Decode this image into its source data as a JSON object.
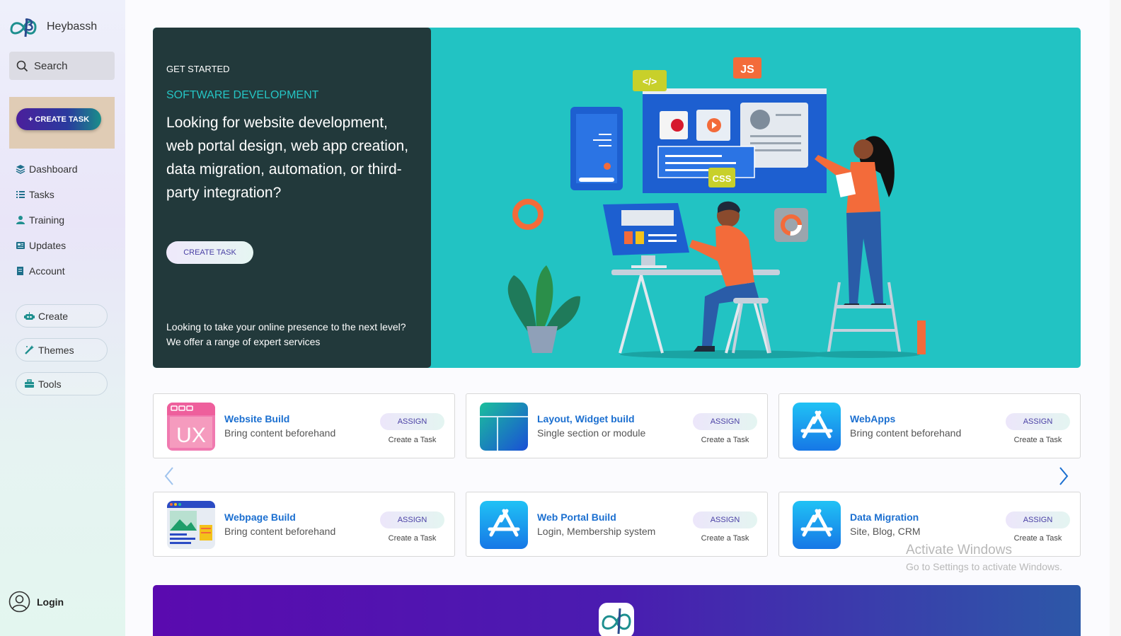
{
  "brand": {
    "name": "Heybassh"
  },
  "search": {
    "placeholder": "Search"
  },
  "sidebar": {
    "create_task_label": "+ CREATE TASK",
    "items": [
      {
        "label": "Dashboard",
        "icon": "layers-icon"
      },
      {
        "label": "Tasks",
        "icon": "list-check-icon"
      },
      {
        "label": "Training",
        "icon": "trainer-icon"
      },
      {
        "label": "Updates",
        "icon": "newspaper-icon"
      },
      {
        "label": "Account",
        "icon": "document-icon"
      }
    ],
    "pills": [
      {
        "label": "Create",
        "icon": "robot-icon"
      },
      {
        "label": "Themes",
        "icon": "magic-wand-icon"
      },
      {
        "label": "Tools",
        "icon": "toolbox-icon"
      }
    ],
    "login_label": "Login"
  },
  "hero": {
    "eyebrow": "GET STARTED",
    "subtitle": "SOFTWARE DEVELOPMENT",
    "title": "Looking for website development, web portal design, web app creation, data migration, automation, or third-party integration?",
    "cta_label": "CREATE TASK",
    "footer_line1": "Looking to take your online presence to the next level?",
    "footer_line2": "We offer a range of expert services",
    "art_labels": {
      "code": "</>",
      "js": "JS",
      "css": "CSS"
    }
  },
  "cards": [
    {
      "title": "Website Build",
      "desc": "Bring content beforehand",
      "assign": "ASSIGN",
      "action": "Create a Task",
      "icon": "ux-design-icon"
    },
    {
      "title": "Layout, Widget build",
      "desc": "Single section or module",
      "assign": "ASSIGN",
      "action": "Create a Task",
      "icon": "layout-icon"
    },
    {
      "title": "WebApps",
      "desc": "Bring content beforehand",
      "assign": "ASSIGN",
      "action": "Create a Task",
      "icon": "app-store-icon"
    },
    {
      "title": "Webpage Build",
      "desc": "Bring content beforehand",
      "assign": "ASSIGN",
      "action": "Create a Task",
      "icon": "webpage-icon"
    },
    {
      "title": "Web Portal Build",
      "desc": "Login, Membership system",
      "assign": "ASSIGN",
      "action": "Create a Task",
      "icon": "app-store-icon"
    },
    {
      "title": "Data Migration",
      "desc": "Site, Blog, CRM",
      "assign": "ASSIGN",
      "action": "Create a Task",
      "icon": "app-store-icon"
    }
  ],
  "watermark": {
    "line1": "Activate Windows",
    "line2": "Go to Settings to activate Windows."
  },
  "colors": {
    "hero_teal": "#22c3c3",
    "hero_dark": "#22393b",
    "link_blue": "#1b6fd0",
    "banner_purple": "#5a0aaf"
  }
}
